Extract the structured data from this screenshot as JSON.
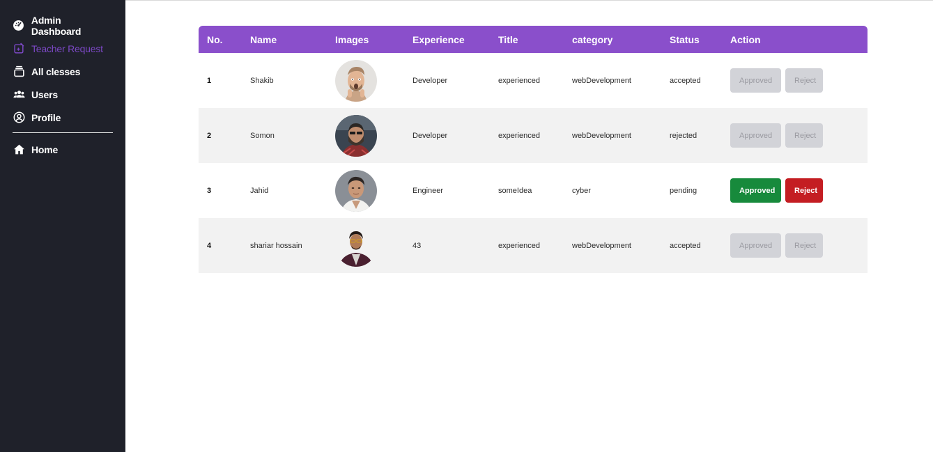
{
  "sidebar": {
    "items": [
      {
        "label": "Admin Dashboard",
        "icon": "dashboard-gauge-icon"
      },
      {
        "label": "Teacher Request",
        "icon": "teacher-request-icon",
        "active": true
      },
      {
        "label": "All clesses",
        "icon": "classes-stack-icon"
      },
      {
        "label": "Users",
        "icon": "users-group-icon"
      },
      {
        "label": "Profile",
        "icon": "profile-circle-icon"
      }
    ],
    "home": {
      "label": "Home",
      "icon": "home-icon"
    }
  },
  "table": {
    "headers": [
      "No.",
      "Name",
      "Images",
      "Experience",
      "Title",
      "category",
      "Status",
      "Action"
    ],
    "rows": [
      {
        "no": "1",
        "name": "Shakib",
        "experience": "Developer",
        "title": "experienced",
        "category": "webDevelopment",
        "status": "accepted",
        "approve_label": "Approved",
        "reject_label": "Reject",
        "approve_enabled": false,
        "reject_enabled": false
      },
      {
        "no": "2",
        "name": "Somon",
        "experience": "Developer",
        "title": "experienced",
        "category": "webDevelopment",
        "status": "rejected",
        "approve_label": "Approved",
        "reject_label": "Reject",
        "approve_enabled": false,
        "reject_enabled": false
      },
      {
        "no": "3",
        "name": "Jahid",
        "experience": "Engineer",
        "title": "someIdea",
        "category": "cyber",
        "status": "pending",
        "approve_label": "Approved",
        "reject_label": "Reject",
        "approve_enabled": true,
        "reject_enabled": true
      },
      {
        "no": "4",
        "name": "shariar hossain",
        "experience": "43",
        "title": "experienced",
        "category": "webDevelopment",
        "status": "accepted",
        "approve_label": "Approved",
        "reject_label": "Reject",
        "approve_enabled": false,
        "reject_enabled": false
      }
    ]
  },
  "colors": {
    "sidebar_bg": "#1f212a",
    "active_nav": "#7b48c4",
    "table_header": "#8a4fcb",
    "approve": "#178a3c",
    "reject": "#c41d22",
    "disabled_button": "#d2d3d8"
  }
}
